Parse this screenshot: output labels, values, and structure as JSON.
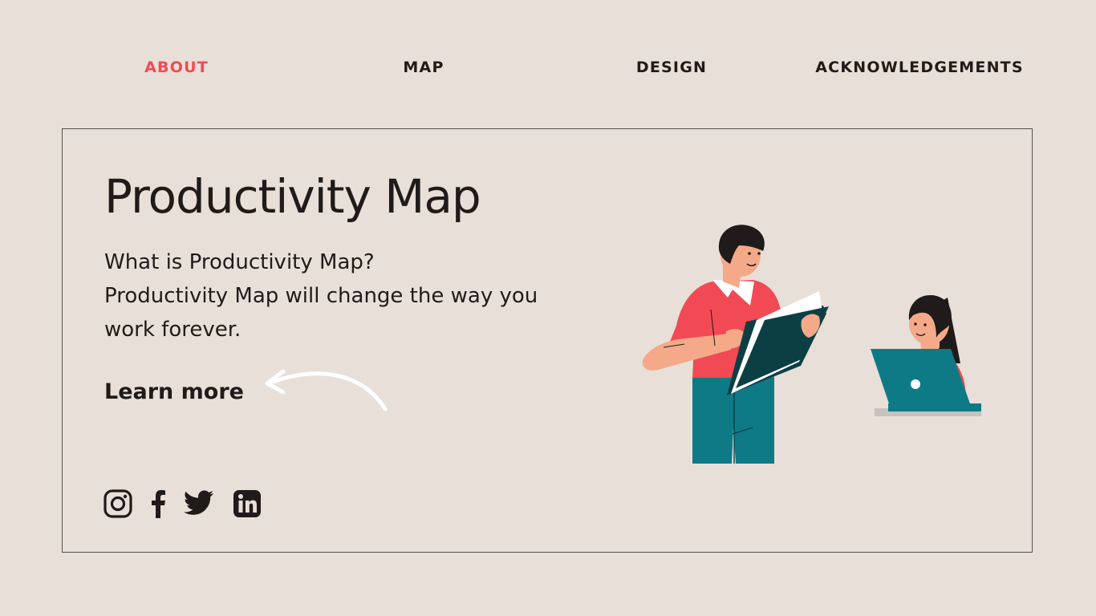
{
  "nav": {
    "items": [
      {
        "label": "ABOUT",
        "active": true
      },
      {
        "label": "MAP",
        "active": false
      },
      {
        "label": "DESIGN",
        "active": false
      },
      {
        "label": "ACKNOWLEDGEMENTS",
        "active": false
      }
    ]
  },
  "hero": {
    "title": "Productivity Map",
    "description": [
      "What is Productivity Map?",
      "Productivity Map will change the way you",
      "work forever."
    ],
    "cta_label": "Learn more"
  },
  "social": {
    "icons": [
      "instagram-icon",
      "facebook-icon",
      "twitter-icon",
      "linkedin-icon"
    ]
  },
  "colors": {
    "background": "#e8dfd8",
    "accent": "#f14a55",
    "text": "#1f1b1a",
    "teal": "#0e7a86",
    "dark_teal": "#0c3f44"
  }
}
